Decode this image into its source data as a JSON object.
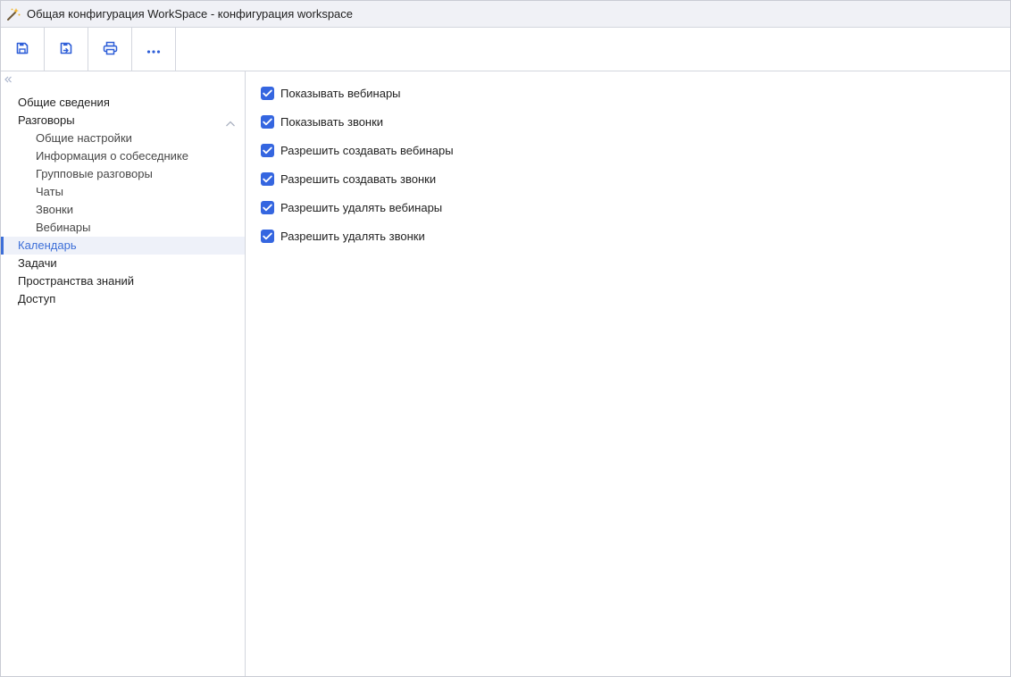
{
  "window": {
    "title": "Общая конфигурация WorkSpace - конфигурация workspace",
    "title_icon": "magic-wand-icon"
  },
  "toolbar": {
    "buttons": [
      {
        "icon": "save-icon"
      },
      {
        "icon": "save-and-close-icon"
      },
      {
        "icon": "print-icon"
      },
      {
        "icon": "more-icon"
      }
    ]
  },
  "sidebar": {
    "collapse_icon": "double-chevron-left-icon",
    "items": [
      {
        "label": "Общие сведения"
      },
      {
        "label": "Разговоры",
        "expanded": true
      },
      {
        "label": "Общие настройки"
      },
      {
        "label": "Информация о собеседнике"
      },
      {
        "label": "Групповые разговоры"
      },
      {
        "label": "Чаты"
      },
      {
        "label": "Звонки"
      },
      {
        "label": "Вебинары"
      },
      {
        "label": "Календарь",
        "active": true
      },
      {
        "label": "Задачи"
      },
      {
        "label": "Пространства знаний"
      },
      {
        "label": "Доступ"
      }
    ]
  },
  "settings": {
    "options": [
      {
        "label": "Показывать вебинары",
        "checked": true
      },
      {
        "label": "Показывать звонки",
        "checked": true
      },
      {
        "label": "Разрешить создавать вебинары",
        "checked": true
      },
      {
        "label": "Разрешить создавать звонки",
        "checked": true
      },
      {
        "label": "Разрешить удалять вебинары",
        "checked": true
      },
      {
        "label": "Разрешить удалять звонки",
        "checked": true
      }
    ]
  },
  "colors": {
    "accent": "#3566e0",
    "active_text": "#3d6fd8",
    "active_bg": "#eef1f9",
    "titlebar_bg": "#f0f1f6",
    "border": "#d3d6de"
  }
}
